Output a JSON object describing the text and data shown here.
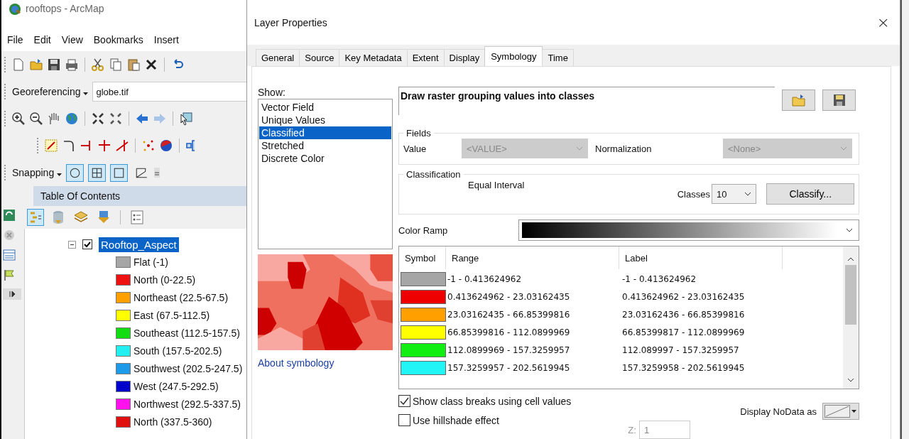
{
  "app_window": {
    "title": "rooftops - ArcMap",
    "menu": [
      "File",
      "Edit",
      "View",
      "Bookmarks",
      "Insert"
    ],
    "georeferencing": {
      "label": "Georeferencing",
      "layer": "globe.tif"
    },
    "snapping": {
      "label": "Snapping"
    },
    "toc": {
      "title": "Table Of Contents",
      "layers": [
        {
          "name": "Rooftop_Aspect",
          "checked": true,
          "expanded": true,
          "selected": true,
          "classes": [
            {
              "label": "Flat (-1)",
              "color": "#a6a6a6"
            },
            {
              "label": "North (0-22.5)",
              "color": "#ee1111"
            },
            {
              "label": "Northeast (22.5-67.5)",
              "color": "#ffa000"
            },
            {
              "label": "East (67.5-112.5)",
              "color": "#ffff00"
            },
            {
              "label": "Southeast (112.5-157.5)",
              "color": "#11dd11"
            },
            {
              "label": "South (157.5-202.5)",
              "color": "#22f0f0"
            },
            {
              "label": "Southwest (202.5-247.5)",
              "color": "#1e9be8"
            },
            {
              "label": "West (247.5-292.5)",
              "color": "#0000cc"
            },
            {
              "label": "Northwest (292.5-337.5)",
              "color": "#ff11ee"
            },
            {
              "label": "North (337.5-360)",
              "color": "#e01010"
            }
          ]
        }
      ]
    }
  },
  "dialog": {
    "title": "Layer Properties",
    "close": "×",
    "tabs": [
      {
        "label": "General",
        "selected": false
      },
      {
        "label": "Source",
        "selected": false
      },
      {
        "label": "Key Metadata",
        "selected": false
      },
      {
        "label": "Extent",
        "selected": false
      },
      {
        "label": "Display",
        "selected": false
      },
      {
        "label": "Symbology",
        "selected": true
      },
      {
        "label": "Time",
        "selected": false
      }
    ],
    "show_label": "Show:",
    "renderers": [
      {
        "label": "Vector Field",
        "selected": false
      },
      {
        "label": "Unique Values",
        "selected": false
      },
      {
        "label": "Classified",
        "selected": true
      },
      {
        "label": "Stretched",
        "selected": false
      },
      {
        "label": "Discrete Color",
        "selected": false
      }
    ],
    "about_link": "About symbology",
    "description": "Draw raster grouping values into classes",
    "fields": {
      "title": "Fields",
      "value_label": "Value",
      "value": "<VALUE>",
      "value_disabled": true,
      "normalization_label": "Normalization",
      "normalization": "<None>",
      "normalization_disabled": true
    },
    "classification": {
      "title": "Classification",
      "method": "Equal Interval",
      "classes_label": "Classes",
      "classes": "10",
      "classify_button": "Classify..."
    },
    "color_ramp_label": "Color Ramp",
    "table": {
      "columns": [
        "Symbol",
        "Range",
        "Label"
      ],
      "rows": [
        {
          "color": "#a6a6a6",
          "range": "-1 - 0.413624962",
          "label": "-1 - 0.413624962"
        },
        {
          "color": "#ee0000",
          "range": "0.413624962 - 23.03162435",
          "label": "0.413624962 - 23.03162435"
        },
        {
          "color": "#ffa000",
          "range": "23.03162435 - 66.85399816",
          "label": "23.03162436 - 66.85399816"
        },
        {
          "color": "#ffff00",
          "range": "66.85399816 - 112.0899969",
          "label": "66.85399817 - 112.0899969"
        },
        {
          "color": "#11ee11",
          "range": "112.0899969 - 157.3259957",
          "label": "112.089997 - 157.3259957"
        },
        {
          "color": "#22f5f5",
          "range": "157.3259957 - 202.5619945",
          "label": "157.3259958 - 202.5619945"
        }
      ]
    },
    "options": [
      {
        "label": "Show class breaks using cell values",
        "checked": true
      },
      {
        "label": "Use hillshade effect",
        "checked": false
      }
    ],
    "z_label": "Z:",
    "z_value": "1",
    "nodata_label": "Display NoData as"
  }
}
